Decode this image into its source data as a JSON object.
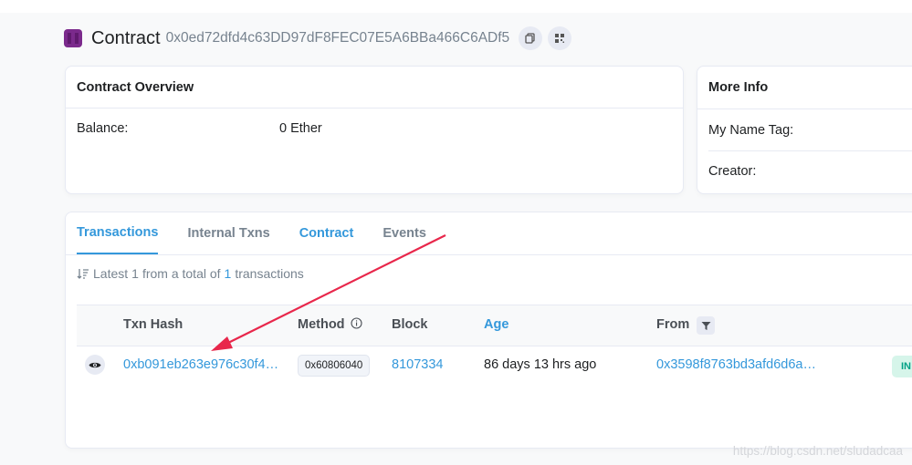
{
  "header": {
    "title": "Contract",
    "address": "0x0ed72dfd4c63DD97dF8FEC07E5A6BBa466C6ADf5",
    "copy_icon": "copy-icon",
    "qr_icon": "qr-code-icon"
  },
  "overview": {
    "title": "Contract Overview",
    "balance_label": "Balance:",
    "balance_value": "0 Ether"
  },
  "more_info": {
    "title": "More Info",
    "name_tag_label": "My Name Tag:",
    "creator_label": "Creator:"
  },
  "tabs": [
    {
      "label": "Transactions",
      "active": true
    },
    {
      "label": "Internal Txns",
      "active": false
    },
    {
      "label": "Contract",
      "active": false
    },
    {
      "label": "Events",
      "active": false
    }
  ],
  "summary": {
    "prefix": "Latest",
    "count_shown": "1",
    "middle": "from a total of",
    "total": "1",
    "suffix": "transactions"
  },
  "table": {
    "headers": [
      "Txn Hash",
      "Method",
      "Block",
      "Age",
      "From"
    ],
    "rows": [
      {
        "txn_hash": "0xb091eb263e976c30f4…",
        "method": "0x60806040",
        "block": "8107334",
        "age": "86 days 13 hrs ago",
        "from": "0x3598f8763bd3afd6d6a…",
        "direction": "IN"
      }
    ]
  },
  "watermark": "https://blog.csdn.net/sludadcaa",
  "colors": {
    "accent": "#3498db",
    "text": "#1e2022",
    "muted": "#77838f",
    "arrow": "#e8274b",
    "in_badge_bg": "#d6f5ea",
    "in_badge_fg": "#00a186"
  }
}
